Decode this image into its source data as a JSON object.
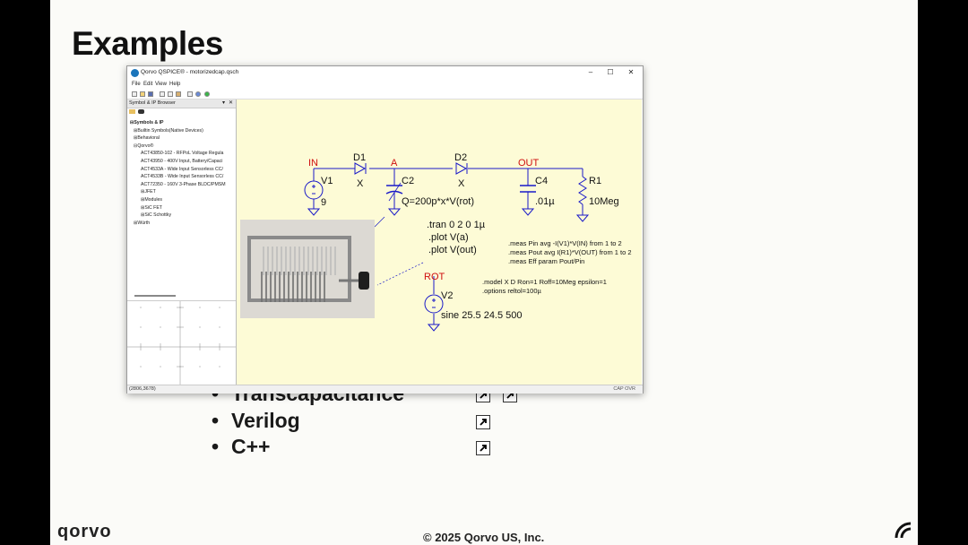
{
  "slide": {
    "title": "Examples",
    "bullets": [
      {
        "text": "Transcapacitance",
        "links": 2
      },
      {
        "text": "Verilog",
        "links": 1
      },
      {
        "text": "C++",
        "links": 1
      }
    ],
    "bullet_glyph": "•",
    "brand": "qorvo",
    "copyright": "© 2025 Qorvo US, Inc.",
    "colors": {
      "background": "#fbfbf8",
      "text": "#111111",
      "border": "#000000"
    }
  },
  "window": {
    "title": "Qorvo QSPICE® - motorizedcap.qsch",
    "controls": {
      "minimize": "–",
      "maximize": "☐",
      "close": "✕"
    },
    "menu": [
      "File",
      "Edit",
      "View",
      "Help"
    ],
    "toolbar_icons": [
      "new-icon",
      "open-icon",
      "save-icon",
      "cut-icon",
      "copy-icon",
      "paste-icon",
      "print-icon",
      "help-icon",
      "run-icon"
    ],
    "panel": {
      "title": "Symbol & IP Browser",
      "pin": "▾",
      "close": "✕",
      "tree": [
        {
          "label": "Symbols & IP",
          "prefix": "⊟",
          "level": 0,
          "bold": true
        },
        {
          "label": "Builtin Symbols(Native Devices)",
          "prefix": "⊞",
          "level": 1
        },
        {
          "label": "Behavioral",
          "prefix": "⊞",
          "level": 1
        },
        {
          "label": "Qorvo®",
          "prefix": "⊟",
          "level": 1
        },
        {
          "label": "ACT43850-102 - RFPoL Voltage Regula",
          "prefix": "",
          "level": 2
        },
        {
          "label": "ACT43950 - 400V Input, Battery/Capaci",
          "prefix": "",
          "level": 2
        },
        {
          "label": "ACT4533A - Wide Input Sensorless CC/",
          "prefix": "",
          "level": 2
        },
        {
          "label": "ACT4533B - Wide Input Sensorless CC/",
          "prefix": "",
          "level": 2
        },
        {
          "label": "ACT72350 - 160V 3-Phase BLDC/PMSM",
          "prefix": "",
          "level": 2
        },
        {
          "label": "JFET",
          "prefix": "⊞",
          "level": 2
        },
        {
          "label": "Modules",
          "prefix": "⊞",
          "level": 2
        },
        {
          "label": "SiC FET",
          "prefix": "⊞",
          "level": 2
        },
        {
          "label": "SiC Schottky",
          "prefix": "⊞",
          "level": 2
        },
        {
          "label": "Würth",
          "prefix": "⊞",
          "level": 1
        }
      ]
    },
    "status": {
      "coords": "(2806,3678)",
      "mode": "CAP OVR"
    }
  },
  "schematic": {
    "nets": {
      "in": "IN",
      "a": "A",
      "out": "OUT",
      "rot": "ROT"
    },
    "parts": {
      "d1": {
        "name": "D1",
        "value": "X"
      },
      "d2": {
        "name": "D2",
        "value": "X"
      },
      "v1": {
        "name": "V1",
        "value": "9"
      },
      "c2": {
        "name": "C2",
        "value": "Q=200p*x*V(rot)"
      },
      "c4": {
        "name": "C4",
        "value": ".01µ"
      },
      "r1": {
        "name": "R1",
        "value": "10Meg"
      },
      "v2": {
        "name": "V2",
        "value": "sine 25.5 24.5 500"
      }
    },
    "directives": [
      ".tran 0 2 0 1µ",
      ".plot V(a)",
      ".plot V(out)"
    ],
    "meas": [
      ".meas Pin avg -I(V1)*V(IN) from 1 to 2",
      ".meas Pout avg I(R1)*V(OUT) from 1 to 2",
      ".meas Eff param Pout/Pin"
    ],
    "model": [
      ".model X D Ron=1 Roff=10Meg epsilon=1",
      ".options reltol=100µ"
    ],
    "colors": {
      "wire": "#1a1ac8",
      "net_label": "#d01010",
      "text": "#000000",
      "canvas": "#fdfbd6"
    }
  }
}
